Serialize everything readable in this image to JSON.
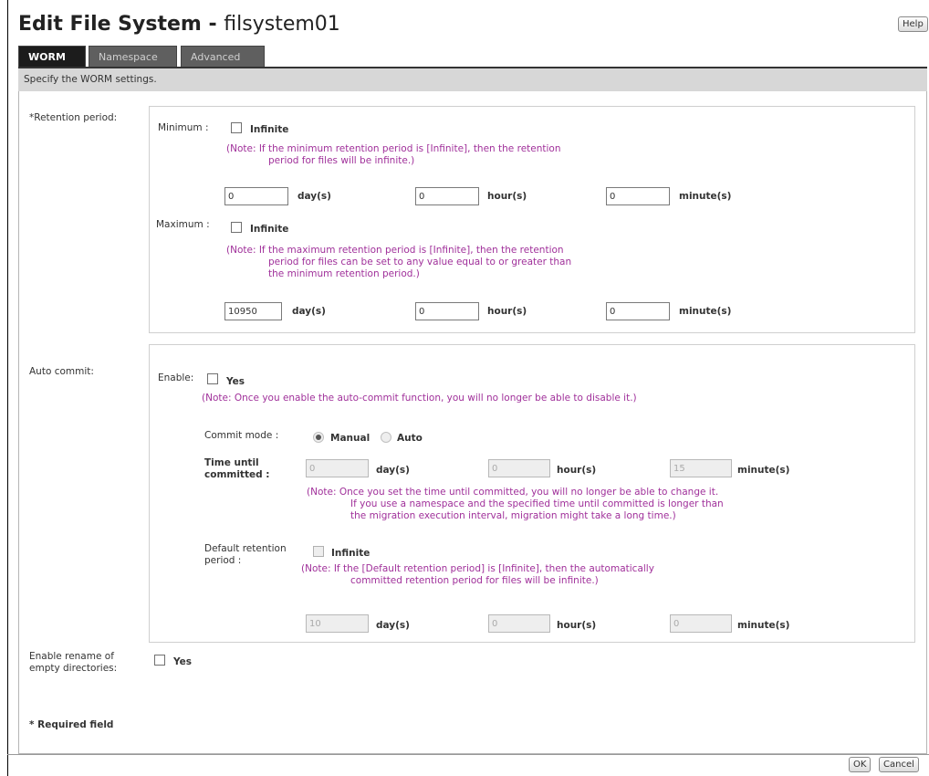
{
  "title": {
    "bold": "Edit File System",
    "sep": " - ",
    "name": "filsystem01"
  },
  "help_label": "Help",
  "tabs": [
    "WORM",
    "Namespace",
    "Advanced"
  ],
  "description": "Specify the WORM settings.",
  "retention": {
    "label": "*Retention period:",
    "minimum": {
      "label": "Minimum :",
      "infinite_label": "Infinite",
      "infinite_checked": false,
      "note_line1": "(Note: If the minimum retention period is [Infinite], then the retention",
      "note_line2": "period for files will be infinite.)",
      "days": "0",
      "hours": "0",
      "minutes": "0"
    },
    "maximum": {
      "label": "Maximum :",
      "infinite_label": "Infinite",
      "infinite_checked": false,
      "note_line1": "(Note: If the maximum retention period is [Infinite], then the retention",
      "note_line2": "period for files can be set to any value equal to or greater than",
      "note_line3": "the minimum retention period.)",
      "days": "10950",
      "hours": "0",
      "minutes": "0"
    }
  },
  "units": {
    "day": "day(s)",
    "hour": "hour(s)",
    "minute": "minute(s)"
  },
  "auto_commit": {
    "label": "Auto commit:",
    "enable_label": "Enable:",
    "yes_label": "Yes",
    "enabled": false,
    "enable_note": "(Note: Once you enable the auto-commit function, you will no longer be able to disable it.)",
    "commit_mode_label": "Commit mode :",
    "mode_options": [
      "Manual",
      "Auto"
    ],
    "mode_selected": "Manual",
    "time_label_line1": "Time until",
    "time_label_line2": "committed :",
    "time_days": "0",
    "time_hours": "0",
    "time_minutes": "15",
    "time_note_line1": "(Note: Once you set the time until committed, you will no longer be able to change it.",
    "time_note_line2": "If you use a namespace and the specified time until committed is longer than",
    "time_note_line3": "the migration execution interval, migration might take a long time.)",
    "default_label_line1": "Default retention",
    "default_label_line2": "period :",
    "default_infinite_label": "Infinite",
    "default_note_line1": "(Note: If the [Default retention period] is [Infinite], then the automatically",
    "default_note_line2": "committed retention period for files will be infinite.)",
    "default_days": "10",
    "default_hours": "0",
    "default_minutes": "0"
  },
  "rename": {
    "label_line1": "Enable rename of",
    "label_line2": "empty directories:",
    "yes_label": "Yes",
    "checked": false
  },
  "required_note": "* Required field",
  "ok_label": "OK",
  "cancel_label": "Cancel"
}
